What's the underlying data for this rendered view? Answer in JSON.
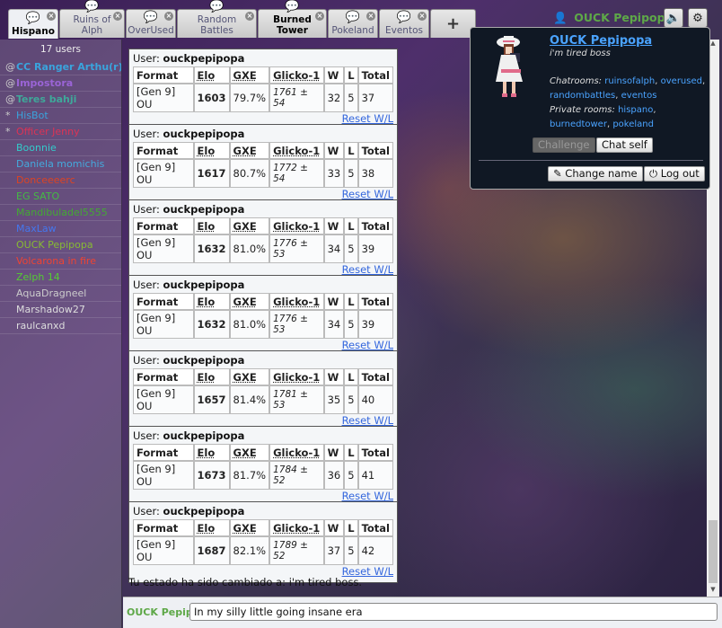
{
  "tabs": [
    {
      "label": "Hispano",
      "icon": "chat-bubble-icon",
      "active": true
    },
    {
      "label": "Ruins of Alph",
      "icon": "chat-bubbles-icon"
    },
    {
      "label": "OverUsed",
      "icon": "chat-bubbles-icon"
    },
    {
      "label": "Random Battles",
      "icon": "chat-bubbles-icon"
    },
    {
      "label": "Burned Tower",
      "icon": "chat-bubble-icon",
      "bold": true
    },
    {
      "label": "Pokeland",
      "icon": "chat-bubbles-icon"
    },
    {
      "label": "Eventos",
      "icon": "chat-bubbles-icon"
    }
  ],
  "add_tab_symbol": "+",
  "tab_close_symbol": "×",
  "header": {
    "username": "OUCK Pepipopa",
    "sound_icon": "speaker-icon",
    "settings_icon": "gear-icon"
  },
  "userlist": {
    "count": "17 users",
    "users": [
      {
        "rank": "@",
        "name": "CC Ranger Arthu(r)",
        "color": "#3aa4dd",
        "bold": true
      },
      {
        "rank": "@",
        "name": "Impostora",
        "color": "#9a64d6",
        "bold": true
      },
      {
        "rank": "@",
        "name": "Teres bahji",
        "color": "#3fa89a",
        "bold": true
      },
      {
        "rank": "*",
        "name": "HisBot",
        "color": "#3aa4dd"
      },
      {
        "rank": "*",
        "name": "Officer Jenny",
        "color": "#dd3355"
      },
      {
        "rank": "",
        "name": "Boonnie",
        "color": "#33cccc"
      },
      {
        "rank": "",
        "name": "Daniela momichis",
        "color": "#44aadd"
      },
      {
        "rank": "",
        "name": "Donceeeerc",
        "color": "#dd4422"
      },
      {
        "rank": "",
        "name": "EG SATO",
        "color": "#44bb44"
      },
      {
        "rank": "",
        "name": "Mandibuladel5555",
        "color": "#44aa33"
      },
      {
        "rank": "",
        "name": "MaxLaw",
        "color": "#4477ee"
      },
      {
        "rank": "",
        "name": "OUCK Pepipopa",
        "color": "#88bb33"
      },
      {
        "rank": "",
        "name": "Volcarona in fire",
        "color": "#ee4433"
      },
      {
        "rank": "",
        "name": "Zelph 14",
        "color": "#55cc33"
      },
      {
        "rank": "",
        "name": "AquaDragneel",
        "color": "#cccccc"
      },
      {
        "rank": "",
        "name": "Marshadow27",
        "color": "#dddddd"
      },
      {
        "rank": "",
        "name": "raulcanxd",
        "color": "#dddddd"
      }
    ]
  },
  "rank_headers": {
    "user_prefix": "User:",
    "format": "Format",
    "elo": "Elo",
    "gxe": "GXE",
    "glicko": "Glicko-1",
    "w": "W",
    "l": "L",
    "total": "Total",
    "reset": "Reset W/L"
  },
  "rank_cards": [
    {
      "user": "ouckpepipopa",
      "format": "[Gen 9] OU",
      "elo": "1603",
      "gxe": "79.7%",
      "glicko": "1761 ± 54",
      "w": "32",
      "l": "5",
      "total": "37"
    },
    {
      "user": "ouckpepipopa",
      "format": "[Gen 9] OU",
      "elo": "1617",
      "gxe": "80.7%",
      "glicko": "1772 ± 54",
      "w": "33",
      "l": "5",
      "total": "38"
    },
    {
      "user": "ouckpepipopa",
      "format": "[Gen 9] OU",
      "elo": "1632",
      "gxe": "81.0%",
      "glicko": "1776 ± 53",
      "w": "34",
      "l": "5",
      "total": "39"
    },
    {
      "user": "ouckpepipopa",
      "format": "[Gen 9] OU",
      "elo": "1632",
      "gxe": "81.0%",
      "glicko": "1776 ± 53",
      "w": "34",
      "l": "5",
      "total": "39"
    },
    {
      "user": "ouckpepipopa",
      "format": "[Gen 9] OU",
      "elo": "1657",
      "gxe": "81.4%",
      "glicko": "1781 ± 53",
      "w": "35",
      "l": "5",
      "total": "40"
    },
    {
      "user": "ouckpepipopa",
      "format": "[Gen 9] OU",
      "elo": "1673",
      "gxe": "81.7%",
      "glicko": "1784 ± 52",
      "w": "36",
      "l": "5",
      "total": "41"
    },
    {
      "user": "ouckpepipopa",
      "format": "[Gen 9] OU",
      "elo": "1687",
      "gxe": "82.1%",
      "glicko": "1789 ± 52",
      "w": "37",
      "l": "5",
      "total": "42"
    }
  ],
  "status_message": "Tu estado ha sido cambiado a: i'm tired boss.",
  "message_bar": {
    "name": "OUCK Pepipopa",
    "input_value": "In my silly little going insane era"
  },
  "popup": {
    "name": "OUCK Pepipopa",
    "status": "i'm tired boss",
    "chatrooms_label": "Chatrooms:",
    "chatrooms": [
      "ruinsofalph",
      "overused",
      "randombattles",
      "eventos"
    ],
    "private_label": "Private rooms:",
    "private_rooms": [
      "hispano",
      "burnedtower",
      "pokeland"
    ],
    "challenge": "Challenge",
    "chat_self": "Chat self",
    "change_name": "Change name",
    "log_out": "Log out",
    "pencil_icon": "pencil-icon",
    "power_icon": "power-icon"
  }
}
